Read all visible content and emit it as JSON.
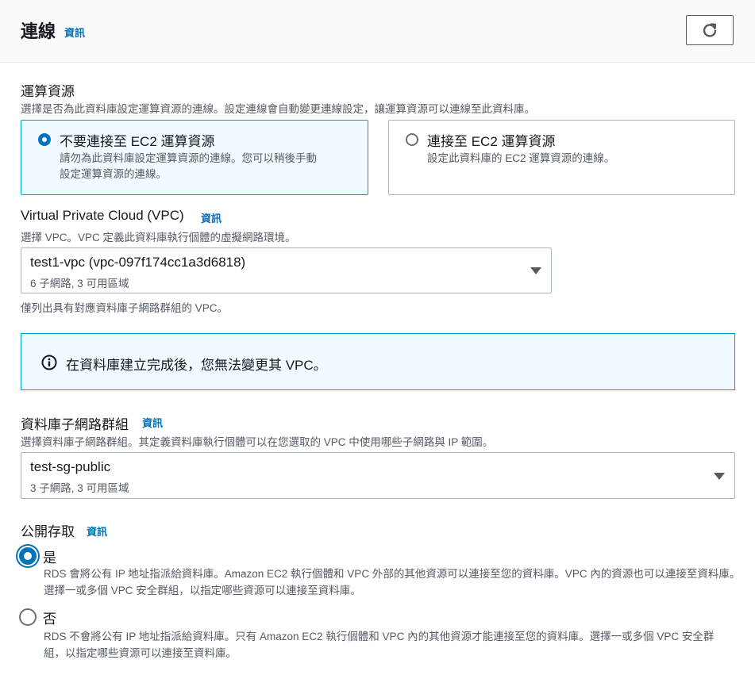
{
  "header": {
    "title": "連線",
    "info": "資訊",
    "refresh_icon": "refresh-icon"
  },
  "compute": {
    "label": "運算資源",
    "description": "選擇是否為此資料庫設定運算資源的連線。設定連線會自動變更連線設定，讓運算資源可以連線至此資料庫。",
    "options": [
      {
        "title": "不要連接至 EC2 運算資源",
        "desc_line1": "請勿為此資料庫設定運算資源的連線。您可以稍後手動",
        "desc_line2": "設定運算資源的連線。",
        "selected": true
      },
      {
        "title": "連接至 EC2 運算資源",
        "desc_line1": "設定此資料庫的 EC2 運算資源的連線。",
        "selected": false
      }
    ]
  },
  "vpc": {
    "label": "Virtual Private Cloud (VPC)",
    "info": "資訊",
    "description": "選擇 VPC。VPC 定義此資料庫執行個體的虛擬網路環境。",
    "value": "test1-vpc (vpc-097f174cc1a3d6818)",
    "sub": "6 子網路, 3 可用區域",
    "hint": "僅列出具有對應資料庫子網路群組的 VPC。"
  },
  "alert": {
    "text": "在資料庫建立完成後，您無法變更其 VPC。",
    "icon": "info-icon"
  },
  "subnet": {
    "label": "資料庫子網路群組",
    "info": "資訊",
    "description": "選擇資料庫子網路群組。其定義資料庫執行個體可以在您選取的 VPC 中使用哪些子網路與 IP 範圍。",
    "value": "test-sg-public",
    "sub": "3 子網路, 3 可用區域"
  },
  "public_access": {
    "label": "公開存取",
    "info": "資訊",
    "options": [
      {
        "title": "是",
        "desc": "RDS 會將公有 IP 地址指派給資料庫。Amazon EC2 執行個體和 VPC 外部的其他資源可以連接至您的資料庫。VPC 內的資源也可以連接至資料庫。選擇一或多個 VPC 安全群組，以指定哪些資源可以連接至資料庫。",
        "selected": true
      },
      {
        "title": "否",
        "desc": "RDS 不會將公有 IP 地址指派給資料庫。只有 Amazon EC2 執行個體和 VPC 內的其他資源才能連接至您的資料庫。選擇一或多個 VPC 安全群組，以指定哪些資源可以連接至資料庫。",
        "selected": false
      }
    ]
  },
  "colors": {
    "accent": "#0073bb",
    "info_border": "#00a1c9",
    "info_bg": "#f1faff"
  }
}
